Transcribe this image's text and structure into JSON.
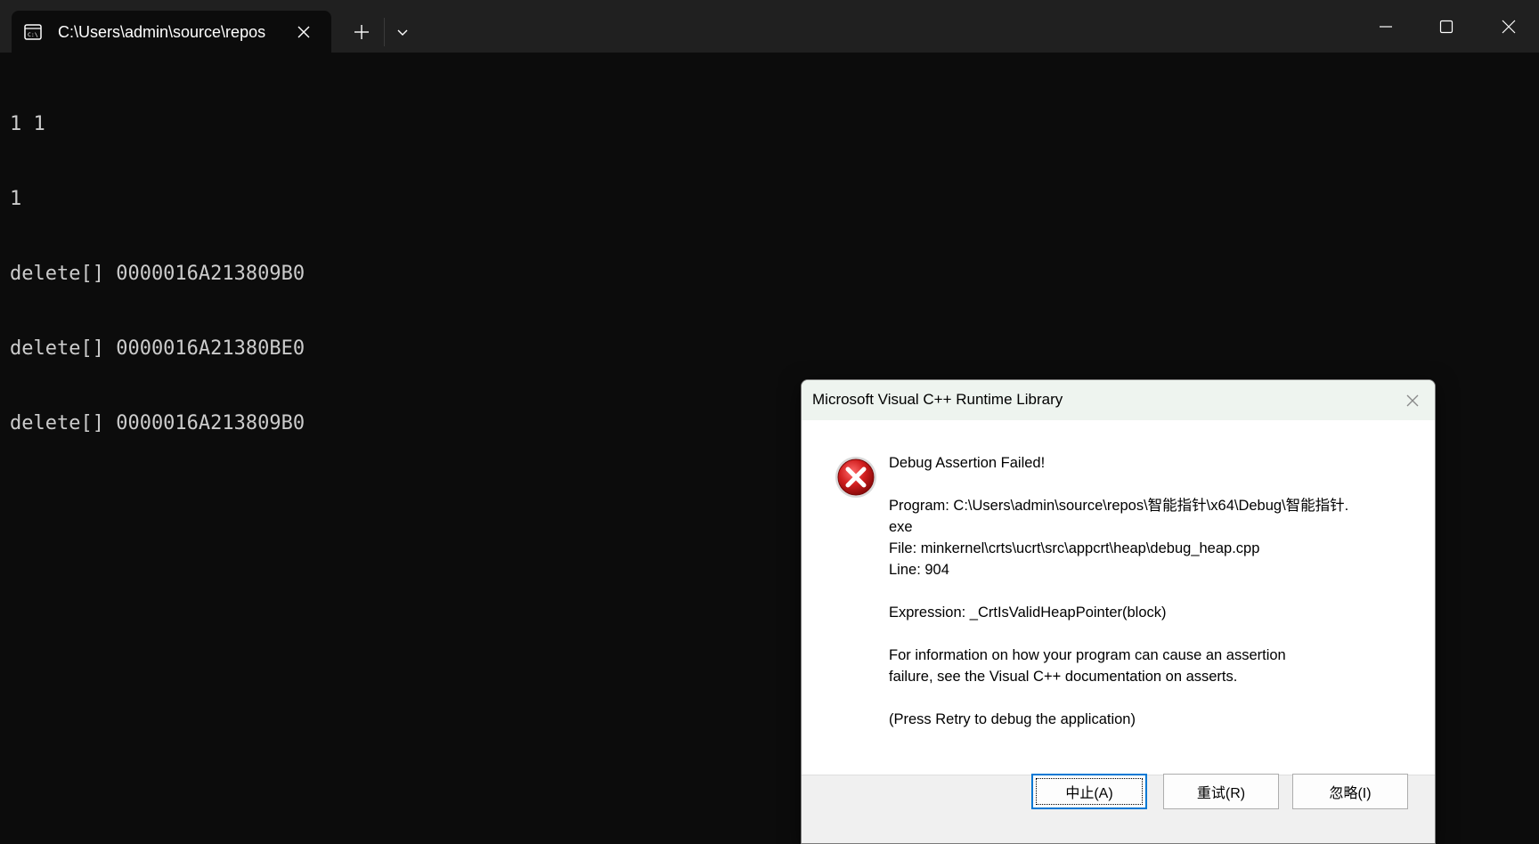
{
  "terminal": {
    "tab_title": "C:\\Users\\admin\\source\\repos",
    "tab_icon": "console-icon",
    "new_tab_icon": "plus-icon",
    "dropdown_icon": "chevron-down-icon",
    "window_controls": [
      "minimize-icon",
      "maximize-icon",
      "close-icon"
    ],
    "background": "#0c0c0c",
    "text_color": "#cccccc",
    "output_lines": [
      "1 1",
      "1",
      "delete[] 0000016A213809B0",
      "delete[] 0000016A21380BE0",
      "delete[] 0000016A213809B0"
    ]
  },
  "dialog": {
    "title": "Microsoft Visual C++ Runtime Library",
    "icon": "error-icon",
    "heading": "Debug Assertion Failed!",
    "program_line": "Program: C:\\Users\\admin\\source\\repos\\智能指针\\x64\\Debug\\智能指针.",
    "program_line_cont": "exe",
    "file_line": "File: minkernel\\crts\\ucrt\\src\\appcrt\\heap\\debug_heap.cpp",
    "line_line": "Line: 904",
    "expression_line": "Expression: _CrtIsValidHeapPointer(block)",
    "info_line_1": "For information on how your program can cause an assertion",
    "info_line_2": "failure, see the Visual C++ documentation on asserts.",
    "retry_hint": "(Press Retry to debug the application)",
    "buttons": {
      "abort": "中止(A)",
      "retry": "重试(R)",
      "ignore": "忽略(I)"
    }
  }
}
